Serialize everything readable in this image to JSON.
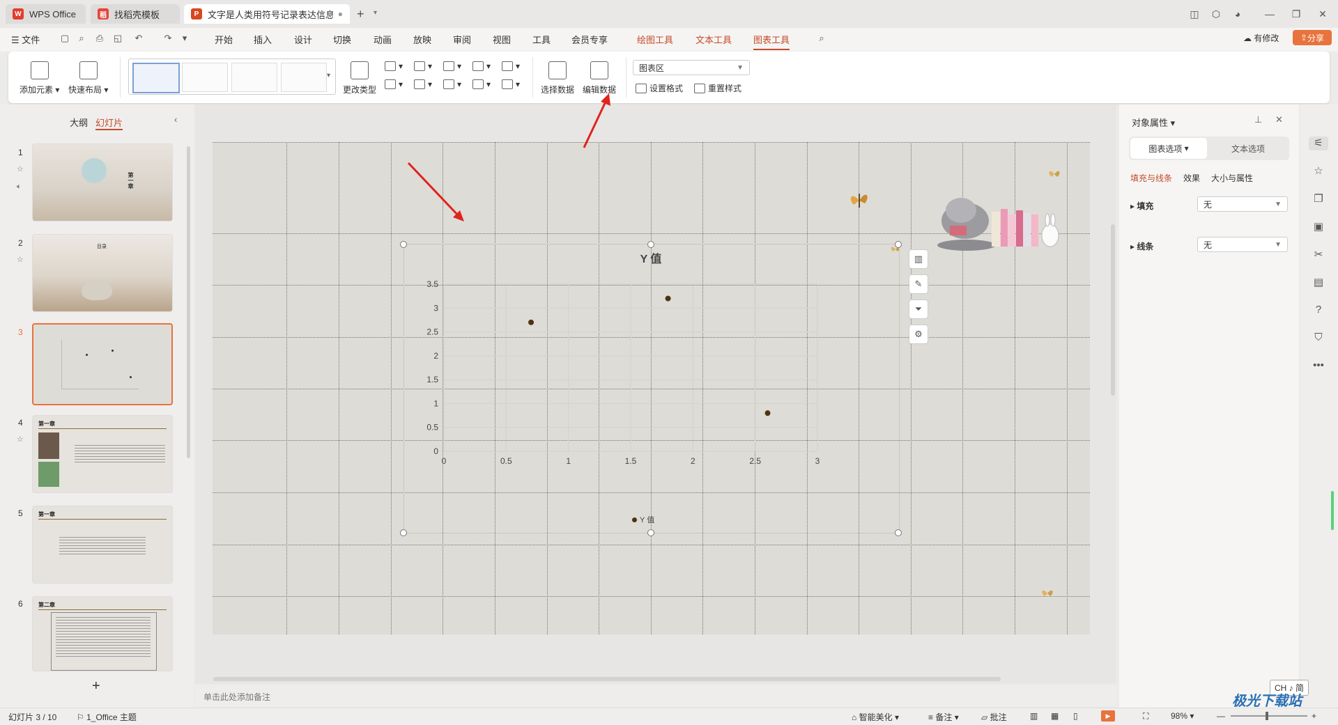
{
  "tabs": [
    {
      "label": "WPS Office"
    },
    {
      "label": "找稻壳模板"
    },
    {
      "label": "文字是人类用符号记录表达信息以..."
    }
  ],
  "menu": {
    "file": "文件",
    "items": [
      "开始",
      "插入",
      "设计",
      "切换",
      "动画",
      "放映",
      "审阅",
      "视图",
      "工具",
      "会员专享"
    ],
    "context": [
      "绘图工具",
      "文本工具",
      "图表工具"
    ],
    "modified": "有修改",
    "share": "分享"
  },
  "ribbon": {
    "add_element": "添加元素",
    "quick_layout": "快速布局",
    "change_type": "更改类型",
    "select_data": "选择数据",
    "edit_data": "编辑数据",
    "area_select": "图表区",
    "set_format": "设置格式",
    "reset_style": "重置样式"
  },
  "left_panel": {
    "outline_tab": "大纲",
    "slides_tab": "幻灯片",
    "slides": [
      {
        "num": "1",
        "title": "第一章"
      },
      {
        "num": "2",
        "title": "目录"
      },
      {
        "num": "3",
        "title": ""
      },
      {
        "num": "4",
        "title": "第一章"
      },
      {
        "num": "5",
        "title": "第一章"
      },
      {
        "num": "6",
        "title": "第二章"
      }
    ]
  },
  "chart_data": {
    "type": "scatter",
    "title": "Y 值",
    "legend": "Y 值",
    "legend_position": "bottom",
    "xlim": [
      0,
      3
    ],
    "ylim": [
      0,
      3.5
    ],
    "x_ticks": [
      "0",
      "0.5",
      "1",
      "1.5",
      "2",
      "2.5",
      "3"
    ],
    "y_ticks": [
      "0",
      "0.5",
      "1",
      "1.5",
      "2",
      "2.5",
      "3",
      "3.5"
    ],
    "series": [
      {
        "name": "Y 值",
        "points": [
          [
            0.7,
            2.7
          ],
          [
            1.8,
            3.2
          ],
          [
            2.6,
            0.8
          ]
        ]
      }
    ],
    "grid": true
  },
  "right_panel": {
    "title": "对象属性",
    "tab_chart": "图表选项",
    "tab_text": "文本选项",
    "sub_fill_line": "填充与线条",
    "sub_effect": "效果",
    "sub_size": "大小与属性",
    "fill_label": "填充",
    "fill_value": "无",
    "line_label": "线条",
    "line_value": "无"
  },
  "notes_placeholder": "单击此处添加备注",
  "status": {
    "slide_info": "幻灯片 3 / 10",
    "theme": "1_Office 主题",
    "beautify": "智能美化",
    "notes": "备注",
    "comments": "批注",
    "zoom": "98%",
    "ime": "CH ♪ 简"
  },
  "watermark": "极光下载站",
  "colors": {
    "accent": "#c44c2a",
    "share_button": "#e8733d",
    "scatter_point": "#4b3510"
  }
}
